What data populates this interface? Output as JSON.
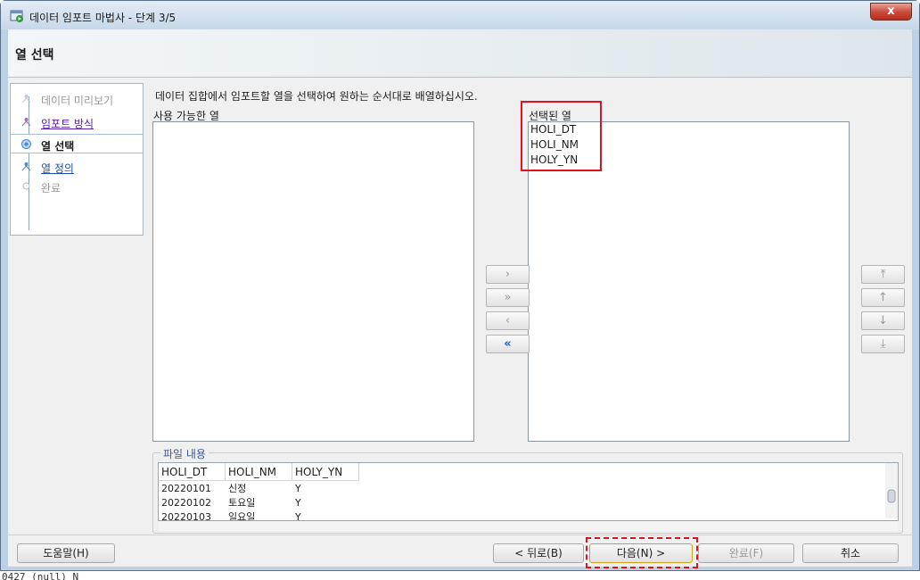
{
  "window": {
    "title": "데이터 임포트 마법사 - 단계 3/5",
    "close_label": "x",
    "icon": "wizard-app-icon"
  },
  "banner": {
    "title": "열 선택"
  },
  "steps": [
    {
      "label": "데이터 미리보기",
      "state": "disabled"
    },
    {
      "label": "임포트 방식",
      "state": "done"
    },
    {
      "label": "열 선택",
      "state": "current"
    },
    {
      "label": "열 정의",
      "state": "link"
    },
    {
      "label": "완료",
      "state": "disabled"
    }
  ],
  "main": {
    "instruction": "데이터 집합에서 임포트할 열을 선택하여 원하는 순서대로 배열하십시오.",
    "available_label": "사용 가능한 열",
    "selected_label": "선택된 열",
    "selected_columns": [
      "HOLI_DT",
      "HOLI_NM",
      "HOLY_YN"
    ]
  },
  "transfer_buttons": [
    {
      "icon": "move-right-icon",
      "glyph": "›",
      "enabled": false
    },
    {
      "icon": "move-all-right-icon",
      "glyph": "»",
      "enabled": false
    },
    {
      "icon": "move-left-icon",
      "glyph": "‹",
      "enabled": false
    },
    {
      "icon": "move-all-left-icon",
      "glyph": "«",
      "enabled": true
    }
  ],
  "order_buttons": [
    {
      "icon": "move-top-icon",
      "glyph": "⤒"
    },
    {
      "icon": "move-up-icon",
      "glyph": "↑"
    },
    {
      "icon": "move-down-icon",
      "glyph": "↓"
    },
    {
      "icon": "move-bottom-icon",
      "glyph": "⤓"
    }
  ],
  "file_content": {
    "legend": "파일 내용",
    "headers": [
      "HOLI_DT",
      "HOLI_NM",
      "HOLY_YN"
    ],
    "rows": [
      [
        "20220101",
        "신정",
        "Y"
      ],
      [
        "20220102",
        "토요일",
        "Y"
      ],
      [
        "20220103",
        "일요일",
        "Y"
      ]
    ]
  },
  "buttons": {
    "help": "도움말(H)",
    "back": "< 뒤로(B)",
    "next": "다음(N) >",
    "finish": "완료(F)",
    "cancel": "취소"
  },
  "background_text": "0427  (null)       N"
}
